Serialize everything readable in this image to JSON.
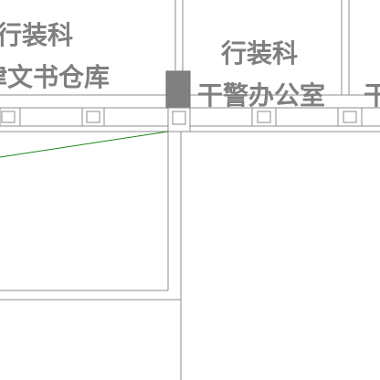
{
  "rooms": {
    "left_room": {
      "dept": "行装科",
      "name": "律文书仓库"
    },
    "right_room": {
      "dept": "行装科",
      "name": "干警办公室"
    },
    "far_right_room": {
      "name_fragment": "干"
    }
  },
  "colors": {
    "wall": "#8c8c8c",
    "label": "#7f7f7f",
    "pillar": "#808080",
    "wire": "#1a8a1a"
  }
}
